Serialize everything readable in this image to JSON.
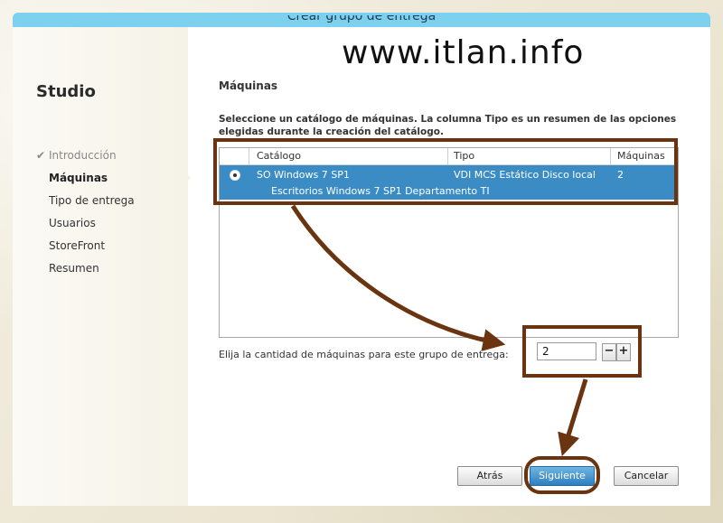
{
  "window": {
    "title": "Crear grupo de entrega"
  },
  "sidebar": {
    "title": "Studio",
    "steps": [
      {
        "label": "Introducción",
        "state": "done"
      },
      {
        "label": "Máquinas",
        "state": "active"
      },
      {
        "label": "Tipo de entrega",
        "state": "pending"
      },
      {
        "label": "Usuarios",
        "state": "pending"
      },
      {
        "label": "StoreFront",
        "state": "pending"
      },
      {
        "label": "Resumen",
        "state": "pending"
      }
    ]
  },
  "main": {
    "section_title": "Máquinas",
    "description": "Seleccione un catálogo de máquinas. La columna Tipo es un resumen de las opciones elegidas durante la creación del catálogo.",
    "table": {
      "headers": [
        "Catálogo",
        "Tipo",
        "Máquinas"
      ],
      "rows": [
        {
          "selected": true,
          "catalog": "SO Windows 7 SP1",
          "subtitle": "Escritorios Windows 7 SP1 Departamento TI",
          "type": "VDI MCS Estático Disco local",
          "machines": "2"
        }
      ]
    },
    "quantity": {
      "label": "Elija la cantidad de máquinas para este grupo de entrega:",
      "value": "2",
      "decrement": "−",
      "increment": "+"
    }
  },
  "footer": {
    "back_label": "Atrás",
    "next_label": "Siguiente",
    "cancel_label": "Cancelar"
  },
  "watermark": "www.itlan.info",
  "colors": {
    "titlebar": "#7ed0ef",
    "selection": "#3b8cc4",
    "annotation": "#6a3410"
  },
  "icons": {
    "done_step": "check-icon",
    "row_select": "radio-icon"
  }
}
